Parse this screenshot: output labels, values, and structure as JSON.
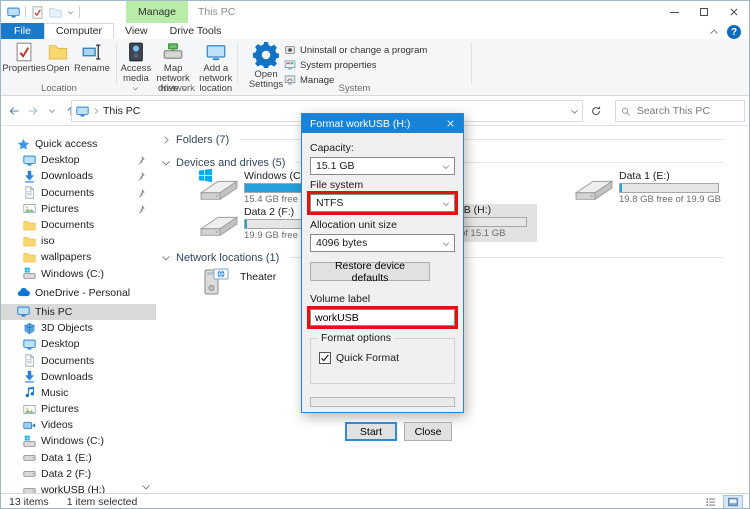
{
  "colors": {
    "accent_blue": "#1883d7",
    "file_tab_blue": "#1979ca",
    "manage_tab_green": "#b9eca8",
    "annotation_red": "#e11212",
    "usage_bar_blue": "#26a0da",
    "selection_gray": "#d9d9d9"
  },
  "icons": {
    "search": "magnifier",
    "refresh": "circular-arrow",
    "help": "question-mark-circle",
    "pin": "pin",
    "quick_access": "star",
    "onedrive": "cloud",
    "settings": "gear"
  },
  "titlebar": {
    "window_title": "This PC",
    "manage_tab": "Manage"
  },
  "tabs": {
    "file": "File",
    "computer": "Computer",
    "view": "View",
    "drive_tools": "Drive Tools"
  },
  "ribbon": {
    "location": {
      "group_label": "Location",
      "properties": "Properties",
      "open": "Open",
      "rename": "Rename"
    },
    "network": {
      "group_label": "Network",
      "access_media": "Access media",
      "map_network_drive": "Map network drive",
      "add_network_location": "Add a network location"
    },
    "system": {
      "group_label": "System",
      "open_settings": "Open Settings",
      "uninstall": "Uninstall or change a program",
      "system_properties": "System properties",
      "manage": "Manage"
    }
  },
  "address": {
    "breadcrumb": "This PC",
    "search_placeholder": "Search This PC"
  },
  "sidebar": {
    "items": [
      {
        "label": "Quick access"
      },
      {
        "label": "Desktop",
        "pinned": true
      },
      {
        "label": "Downloads",
        "pinned": true
      },
      {
        "label": "Documents",
        "pinned": true
      },
      {
        "label": "Pictures",
        "pinned": true
      },
      {
        "label": "Documents"
      },
      {
        "label": "iso"
      },
      {
        "label": "wallpapers"
      },
      {
        "label": "Windows (C:)"
      },
      {
        "label": "OneDrive - Personal"
      },
      {
        "label": "This PC",
        "selected": true
      },
      {
        "label": "3D Objects"
      },
      {
        "label": "Desktop"
      },
      {
        "label": "Documents"
      },
      {
        "label": "Downloads"
      },
      {
        "label": "Music"
      },
      {
        "label": "Pictures"
      },
      {
        "label": "Videos"
      },
      {
        "label": "Windows (C:)"
      },
      {
        "label": "Data 1 (E:)"
      },
      {
        "label": "Data 2 (F:)"
      },
      {
        "label": "workUSB (H:)"
      }
    ]
  },
  "main": {
    "groups": {
      "folders": "Folders (7)",
      "devices": "Devices and drives (5)",
      "network": "Network locations (1)"
    },
    "drives": {
      "windows_c": {
        "name": "Windows (C:)",
        "detail": "15.4 GB free of 68.",
        "fill_pct": 78
      },
      "data2_f": {
        "name": "Data 2 (F:)",
        "detail": "19.9 GB free of 19.",
        "fill_pct": 2
      },
      "data1_e": {
        "name": "Data 1 (E:)",
        "detail": "19.8 GB free of 19.9 GB",
        "fill_pct": 2
      },
      "workusb_h": {
        "name": "workUSB (H:)",
        "detail": "of 15.1 GB",
        "fill_pct": 2,
        "selected": true
      }
    },
    "network_items": {
      "theater": "Theater"
    }
  },
  "dialog": {
    "title": "Format workUSB (H:)",
    "capacity_label": "Capacity:",
    "capacity_value": "15.1 GB",
    "file_system_label": "File system",
    "file_system_value": "NTFS",
    "allocation_label": "Allocation unit size",
    "allocation_value": "4096 bytes",
    "restore_defaults": "Restore device defaults",
    "volume_label": "Volume label",
    "volume_value": "workUSB",
    "format_options": "Format options",
    "quick_format": "Quick Format",
    "quick_format_checked": true,
    "start": "Start",
    "close": "Close"
  },
  "statusbar": {
    "item_count": "13 items",
    "selection": "1 item selected"
  }
}
